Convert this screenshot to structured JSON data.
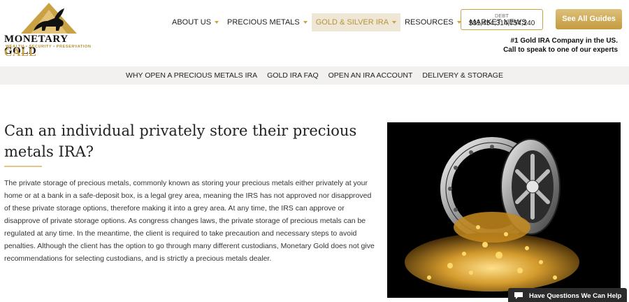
{
  "header": {
    "logo_name": "MONETARY GOLD",
    "logo_tagline": "WEALTH • SECURITY • PRESERVATION",
    "call_label": "CALL",
    "nav": [
      {
        "label": "ABOUT US",
        "has_caret": true
      },
      {
        "label": "PRECIOUS METALS",
        "has_caret": true
      },
      {
        "label": "GOLD & SILVER IRA",
        "has_caret": true,
        "active": true
      },
      {
        "label": "RESOURCES",
        "has_caret": true
      },
      {
        "label": "MARKET NEWS",
        "has_caret": false
      }
    ],
    "debt_label": "DEBT",
    "debt_value": "$31,454,314,754,240",
    "guides_button": "See All Guides",
    "promo_line1": "#1 Gold IRA Company in the US.",
    "promo_line2": "Call to speak to one of our experts"
  },
  "subnav": [
    "WHY OPEN A PRECIOUS METALS IRA",
    "GOLD IRA FAQ",
    "OPEN AN IRA ACCOUNT",
    "DELIVERY & STORAGE"
  ],
  "main": {
    "title": "Can an individual privately store their precious metals IRA?",
    "body": "The private storage of precious metals, commonly known as storing your precious metals either privately at your home or at a bank in a safe-deposit box, is a legal grey area, meaning the IRS has not approved nor disapproved of these private storage options, therefore making it into a grey area. At any time, the IRS can approve or disapprove of private storage options. As congress changes laws, the private storage of precious metals can be regulated at any time. In the meantime, the client is required to take precaution and necessary steps to avoid penalties. Although the client has the option to go through many different custodians, Monetary Gold does not give recommendations for selecting custodians, and is strictly a precious metals dealer."
  },
  "chat": {
    "label": "Have Questions We Can Help",
    "icon": "chat-bubble-icon"
  },
  "colors": {
    "gold": "#c9a243",
    "active_nav_bg": "#efe7d6",
    "subnav_bg": "#f2f1ef",
    "chat_bg": "#2b2b2b"
  }
}
